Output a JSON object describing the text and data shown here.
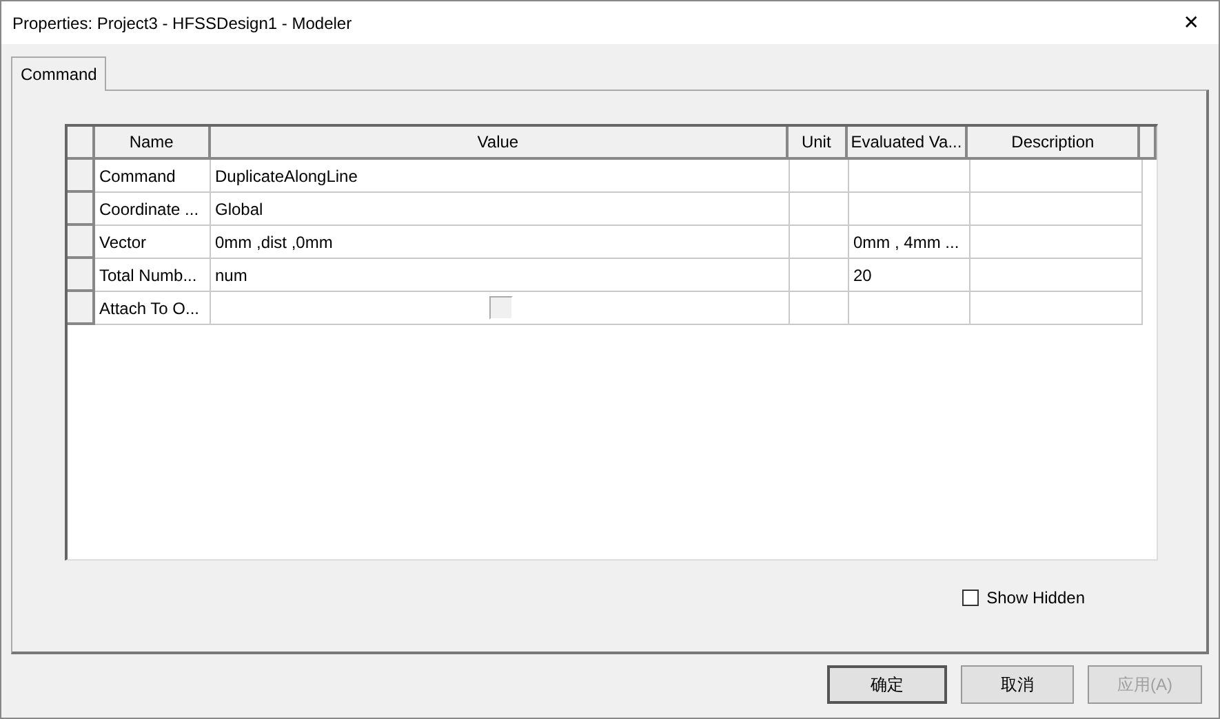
{
  "window": {
    "title": "Properties: Project3 - HFSSDesign1 - Modeler",
    "close": "✕"
  },
  "tabs": [
    {
      "label": "Command",
      "selected": true
    }
  ],
  "table": {
    "columns": [
      "Name",
      "Value",
      "Unit",
      "Evaluated Va...",
      "Description"
    ],
    "rows": [
      {
        "name": "Command",
        "value": {
          "kind": "text",
          "text": "DuplicateAlongLine"
        }
      },
      {
        "name": "Coordinate ...",
        "value": {
          "kind": "text",
          "text": "Global"
        }
      },
      {
        "name": "Vector",
        "value": {
          "kind": "text",
          "text": "0mm ,dist ,0mm"
        },
        "evaluated": "0mm , 4mm ..."
      },
      {
        "name": "Total Numb...",
        "value": {
          "kind": "text",
          "text": "num"
        },
        "evaluated": "20"
      },
      {
        "name": "Attach To O...",
        "value": {
          "kind": "checkbox",
          "checked": false
        }
      }
    ]
  },
  "show_hidden": {
    "label": "Show Hidden",
    "checked": false
  },
  "buttons": [
    {
      "label": "确定",
      "default": true,
      "disabled": false
    },
    {
      "label": "取消",
      "default": false,
      "disabled": false
    },
    {
      "label": "应用(A)",
      "default": false,
      "disabled": true
    }
  ]
}
